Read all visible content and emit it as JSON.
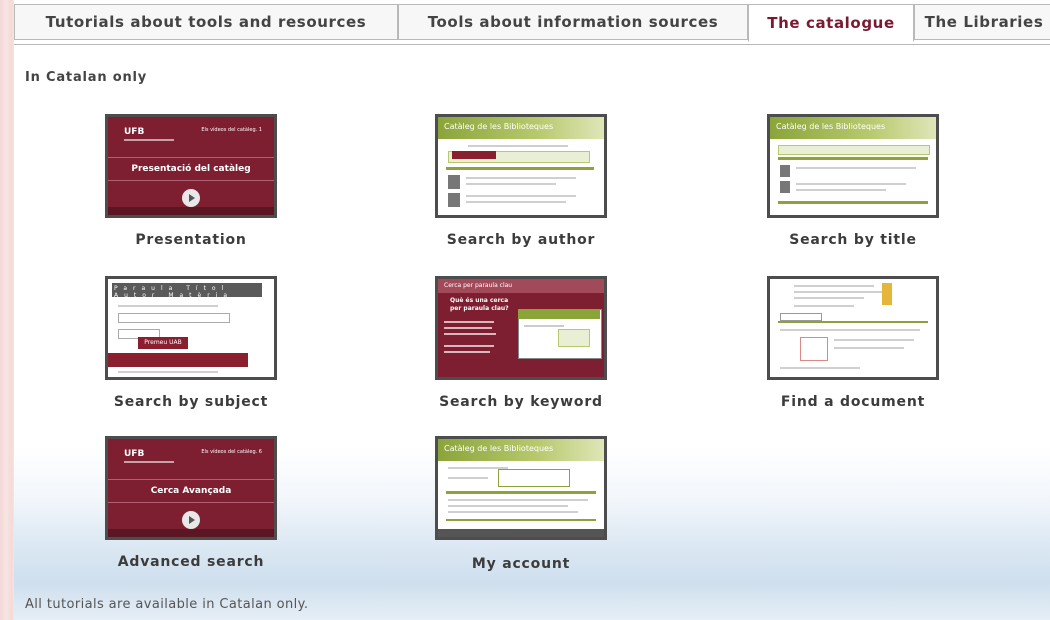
{
  "tabs": [
    {
      "label": "Tutorials about tools and resources",
      "active": false
    },
    {
      "label": "Tools about information sources",
      "active": false
    },
    {
      "label": "The catalogue",
      "active": true
    },
    {
      "label": "The Libraries",
      "active": false
    }
  ],
  "note": "In Catalan only",
  "tutorials": [
    {
      "caption": "Presentation",
      "thumb": {
        "logo": "UFB",
        "corner": "Els vídeos del catàleg. 1",
        "title": "Presentació del catàleg"
      }
    },
    {
      "caption": "Search by author",
      "thumb": {
        "header": "Catàleg de les Biblioteques"
      }
    },
    {
      "caption": "Search by title",
      "thumb": {
        "header": "Catàleg de les Biblioteques"
      }
    },
    {
      "caption": "Search by subject",
      "thumb": {
        "tabs": [
          "Paraula",
          "Títol",
          "Autor",
          "Matèria"
        ],
        "button": "Premeu UAB"
      }
    },
    {
      "caption": "Search by keyword",
      "thumb": {
        "header": "Cerca per paraula clau",
        "question": "Què és una cerca per paraula clau?"
      }
    },
    {
      "caption": "Find a document",
      "thumb": {}
    },
    {
      "caption": "Advanced search",
      "thumb": {
        "logo": "UFB",
        "corner": "Els vídeos del catàleg. 6",
        "title": "Cerca Avançada"
      }
    },
    {
      "caption": "My account",
      "thumb": {
        "header": "Catàleg de les Biblioteques"
      }
    }
  ],
  "footer": "All tutorials are available in Catalan only.",
  "colors": {
    "accent": "#7a1a32",
    "maroon": "#7d1f30",
    "green": "#8ba43a"
  }
}
